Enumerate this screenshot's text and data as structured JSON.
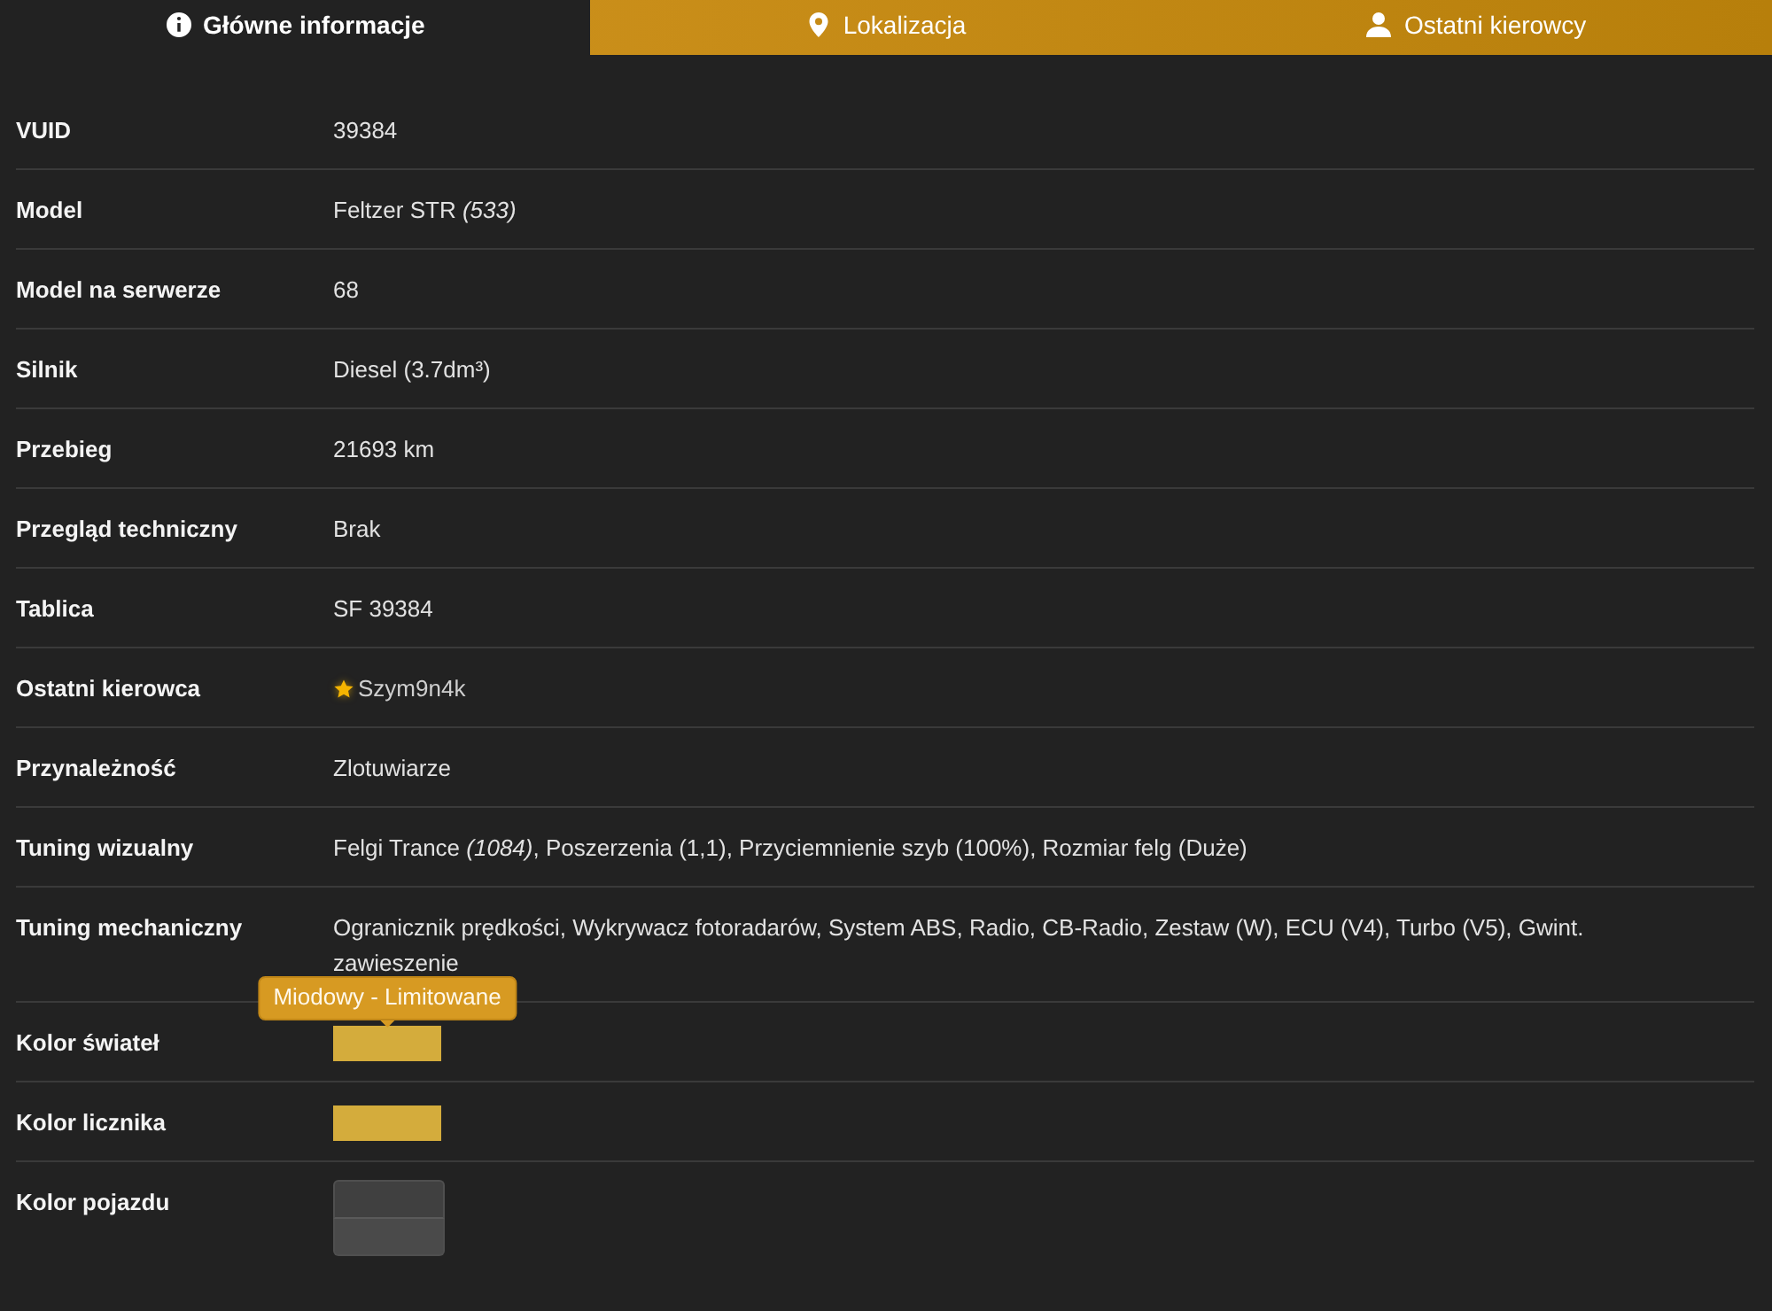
{
  "tabs": [
    {
      "label": "Główne informacje",
      "selected": true
    },
    {
      "label": "Lokalizacja",
      "selected": false
    },
    {
      "label": "Ostatni kierowcy",
      "selected": false
    }
  ],
  "rows": [
    {
      "kind": "text",
      "label": "VUID",
      "value": "39384"
    },
    {
      "kind": "text",
      "label": "Model",
      "value": "Feltzer STR *(533)*"
    },
    {
      "kind": "text",
      "label": "Model na serwerze",
      "value": "68"
    },
    {
      "kind": "text",
      "label": "Silnik",
      "value": "Diesel (3.7dm³)"
    },
    {
      "kind": "text",
      "label": "Przebieg",
      "value": "21693 km"
    },
    {
      "kind": "text",
      "label": "Przegląd techniczny",
      "value": "Brak"
    },
    {
      "kind": "text",
      "label": "Tablica",
      "value": "SF 39384"
    },
    {
      "kind": "driver",
      "label": "Ostatni kierowca",
      "value": "Szym9n4k",
      "starred": true
    },
    {
      "kind": "text",
      "label": "Przynależność",
      "value": "Zlotuwiarze"
    },
    {
      "kind": "text",
      "label": "Tuning wizualny",
      "value": "Felgi Trance *(1084)*, Poszerzenia (1,1), Przyciemnienie szyb (100%), Rozmiar felg (Duże)"
    },
    {
      "kind": "text",
      "label": "Tuning mechaniczny",
      "value": "Ogranicznik prędkości, Wykrywacz fotoradarów, System ABS, Radio, CB-Radio, Zestaw (W), ECU (V4), Turbo (V5), Gwint. zawieszenie"
    },
    {
      "kind": "swatches",
      "label": "Kolor świateł",
      "swatches": [
        {
          "color": "#d4ac3c",
          "tooltip": "Miodowy - Limitowane"
        }
      ]
    },
    {
      "kind": "swatches",
      "label": "Kolor licznika",
      "swatches": [
        {
          "color": "#d4ac3c"
        }
      ]
    },
    {
      "kind": "swatches",
      "label": "Kolor pojazdu",
      "swatches": [
        {
          "color": "#404040"
        },
        {
          "color": "#4a4a4a"
        }
      ]
    }
  ]
}
